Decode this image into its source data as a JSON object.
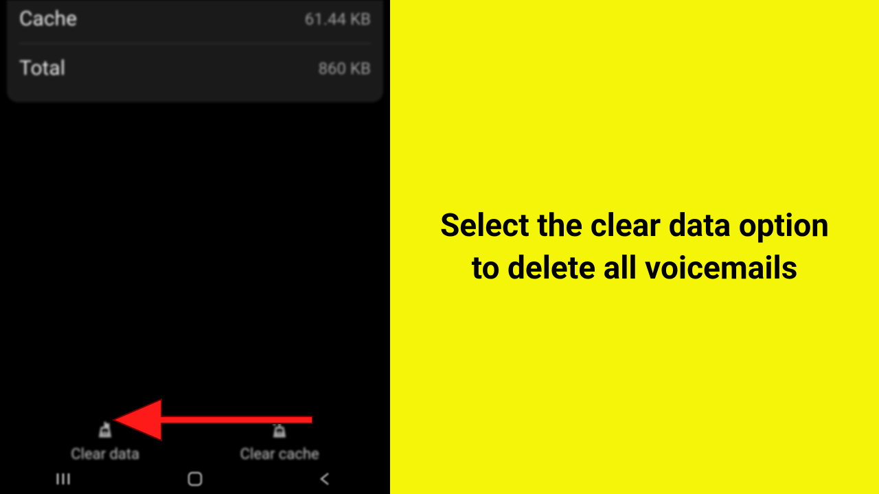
{
  "storage": {
    "cache_label": "Cache",
    "cache_value": "61.44 KB",
    "total_label": "Total",
    "total_value": "860 KB"
  },
  "actions": {
    "clear_data": "Clear data",
    "clear_cache": "Clear cache"
  },
  "instruction": "Select the clear data option to delete all voicemails"
}
